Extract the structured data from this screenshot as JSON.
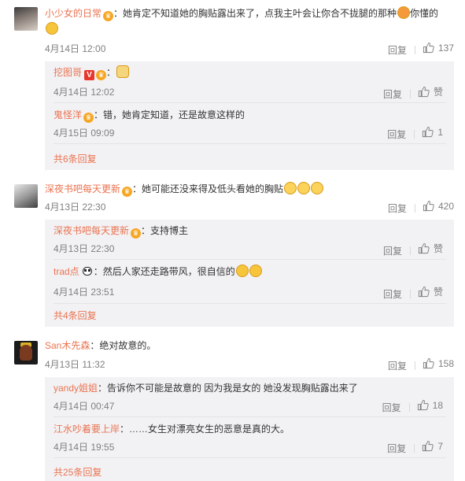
{
  "reply_label": "回复",
  "like_label": "赞",
  "comments": [
    {
      "user": "小少女的日常",
      "text": "：她肯定不知道她的胸贴露出来了，点我主叶会让你合不拢腿的那种",
      "text_tail": "你懂的",
      "time": "4月14日 12:00",
      "likes": "137",
      "replies": [
        {
          "user": "挖图哥",
          "text": "：",
          "time": "4月14日 12:02",
          "likes": "赞"
        },
        {
          "user": "鬼怪洋",
          "text": "：错，她肯定知道，还是故意这样的",
          "time": "4月15日 09:09",
          "likes": "1"
        }
      ],
      "more": "共6条回复"
    },
    {
      "user": "深夜书吧每天更新",
      "text": "：她可能还没来得及低头看她的胸贴",
      "time": "4月13日 22:30",
      "likes": "420",
      "replies": [
        {
          "user": "深夜书吧每天更新",
          "text": "：支持博主",
          "time": "4月13日 22:30",
          "likes": "赞"
        },
        {
          "user": "trad点",
          "text": "：然后人家还走路带风，很自信的",
          "time": "4月14日 23:51",
          "likes": "赞"
        }
      ],
      "more": "共4条回复"
    },
    {
      "user": "San木先森",
      "text": "：绝对故意的。",
      "time": "4月13日 11:32",
      "likes": "158",
      "replies": [
        {
          "user": "yandy姐姐",
          "text": "：告诉你不可能是故意的 因为我是女的 她没发现胸贴露出来了",
          "time": "4月14日 00:47",
          "likes": "18"
        },
        {
          "user": "江水吵着要上岸",
          "text": "：……女生对漂亮女生的恶意是真的大。",
          "time": "4月14日 19:55",
          "likes": "7"
        }
      ],
      "more": "共25条回复"
    }
  ]
}
